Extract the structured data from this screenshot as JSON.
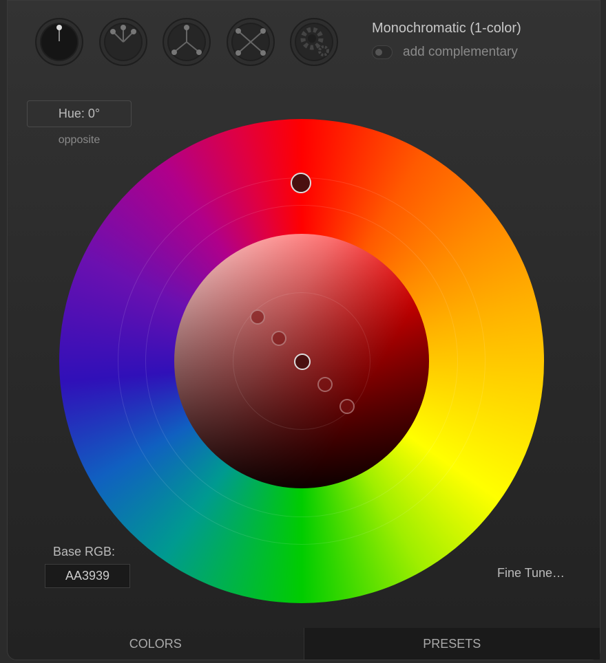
{
  "modes": [
    {
      "name": "monochromatic",
      "active": true
    },
    {
      "name": "analogic"
    },
    {
      "name": "triad"
    },
    {
      "name": "tetrad"
    },
    {
      "name": "custom"
    }
  ],
  "header": {
    "title": "Monochromatic (1-color)",
    "add_complementary": "add complementary"
  },
  "hue": {
    "label": "Hue: 0°",
    "opposite": "opposite"
  },
  "base": {
    "label": "Base RGB:",
    "value": "AA3939"
  },
  "fine_tune": "Fine Tune…",
  "tabs": [
    {
      "label": "COLORS"
    },
    {
      "label": "PRESETS",
      "selected": true
    }
  ]
}
